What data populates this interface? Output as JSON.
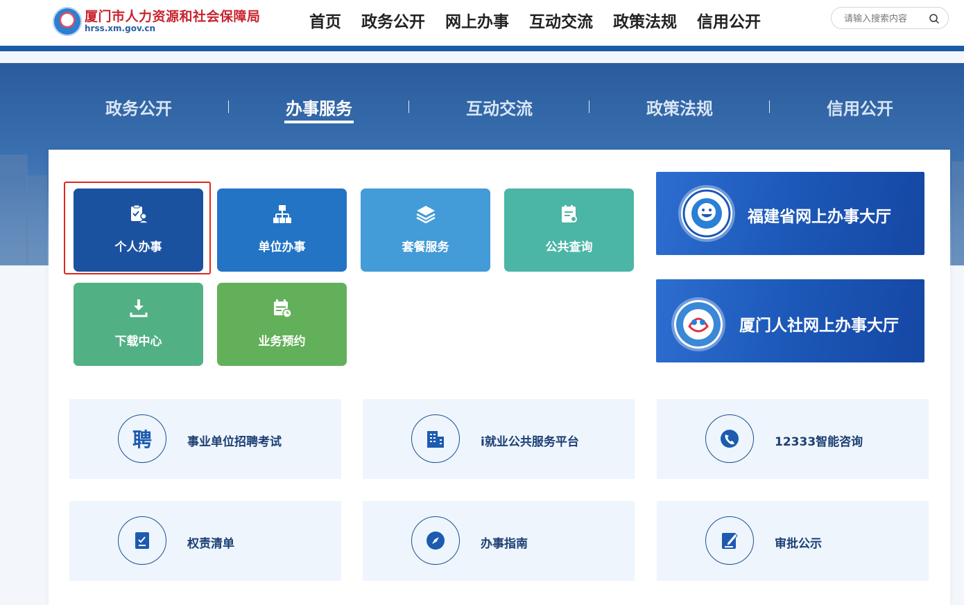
{
  "site": {
    "name": "厦门市人力资源和社会保障局",
    "domain": "hrss.xm.gov.cn"
  },
  "top_nav": [
    "首页",
    "政务公开",
    "网上办事",
    "互动交流",
    "政策法规",
    "信用公开"
  ],
  "search": {
    "placeholder": "请输入搜索内容"
  },
  "section_nav": {
    "items": [
      "政务公开",
      "办事服务",
      "互动交流",
      "政策法规",
      "信用公开"
    ],
    "active": "办事服务"
  },
  "service_tiles": [
    {
      "label": "个人办事",
      "icon": "clipboard-person-icon",
      "color": "#1b52a0",
      "highlighted": true
    },
    {
      "label": "单位办事",
      "icon": "org-chart-icon",
      "color": "#2374c4"
    },
    {
      "label": "套餐服务",
      "icon": "layers-icon",
      "color": "#439bd8"
    },
    {
      "label": "公共查询",
      "icon": "document-search-icon",
      "color": "#4bb5a6"
    },
    {
      "label": "下载中心",
      "icon": "download-icon",
      "color": "#52b085"
    },
    {
      "label": "业务预约",
      "icon": "calendar-clock-icon",
      "color": "#63b05a"
    }
  ],
  "service_halls": [
    {
      "title": "福建省网上办事大厅",
      "emblem": "fujian-hall-emblem"
    },
    {
      "title": "厦门人社网上办事大厅",
      "emblem": "xiamen-hrss-emblem"
    }
  ],
  "quick_links": [
    {
      "label": "事业单位招聘考试",
      "icon": "recruit-char-icon",
      "glyph": "聘"
    },
    {
      "label": "i就业公共服务平台",
      "icon": "building-icon"
    },
    {
      "label": "12333智能咨询",
      "icon": "phone-consult-icon"
    },
    {
      "label": "权责清单",
      "icon": "checklist-icon"
    },
    {
      "label": "办事指南",
      "icon": "compass-icon"
    },
    {
      "label": "审批公示",
      "icon": "edit-doc-icon"
    }
  ]
}
